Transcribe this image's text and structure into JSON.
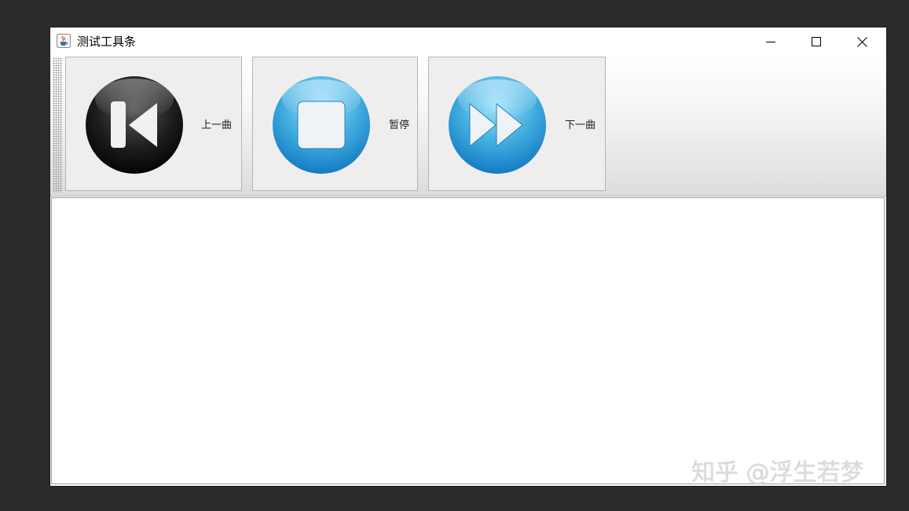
{
  "window": {
    "title": "测试工具条",
    "app_icon": "java-cup-icon",
    "controls": {
      "minimize_icon": "minimize-icon",
      "maximize_icon": "maximize-icon",
      "close_icon": "close-icon"
    }
  },
  "toolbar": {
    "buttons": [
      {
        "label": "上一曲",
        "icon": "skip-previous-icon",
        "icon_color": "#1a1a1a"
      },
      {
        "label": "暂停",
        "icon": "stop-icon",
        "icon_color": "#2a9bd8"
      },
      {
        "label": "下一曲",
        "icon": "fast-forward-icon",
        "icon_color": "#2a9bd8"
      }
    ]
  },
  "watermark": "知乎 @浮生若梦",
  "colors": {
    "desktop": "#2b2b2b",
    "button_bg": "#eeeeee",
    "blue_icon": "#2a9bd8",
    "black_icon": "#1a1a1a"
  }
}
